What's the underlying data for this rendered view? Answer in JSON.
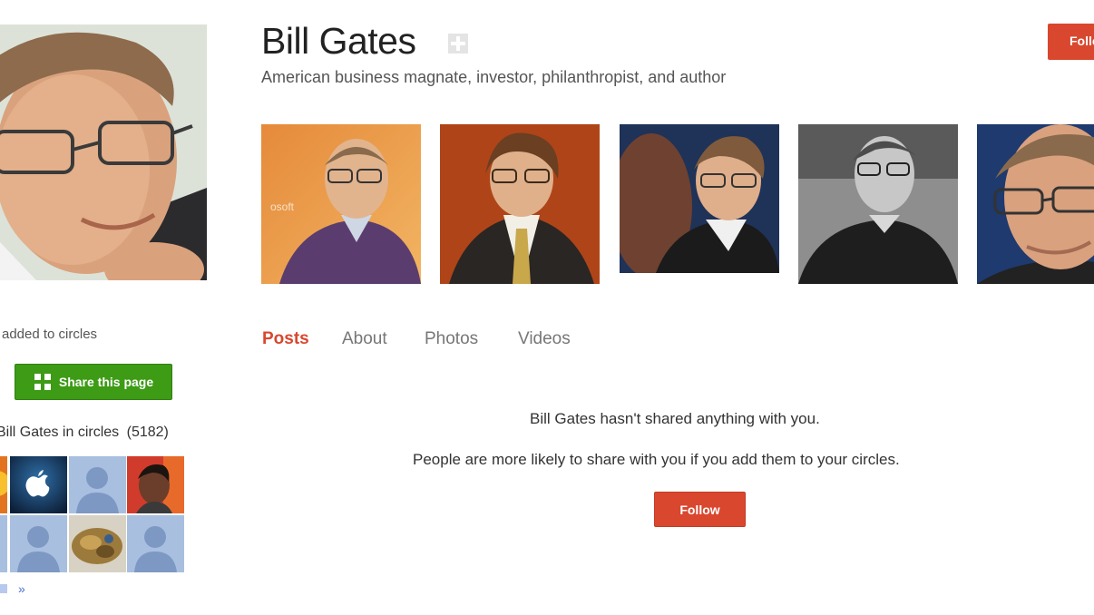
{
  "profile": {
    "name": "Bill Gates",
    "tagline": "American business magnate, investor, philanthropist, and author",
    "photo_icon": "profile-photo",
    "verify_icon": "google-plus-badge-icon"
  },
  "header": {
    "follow_label": "Follow"
  },
  "sidebar": {
    "added_text": "added to circles",
    "share_label": "Share this page",
    "circles_title": "Bill Gates in circles",
    "circles_count": "5182",
    "more_link": "»"
  },
  "tabs": [
    {
      "label": "Posts",
      "active": true
    },
    {
      "label": "About",
      "active": false
    },
    {
      "label": "Photos",
      "active": false
    },
    {
      "label": "Videos",
      "active": false
    }
  ],
  "empty_state": {
    "line1": "Bill Gates hasn't shared anything with you.",
    "line2": "People are more likely to share with you if you add them to your circles.",
    "follow_label": "Follow"
  },
  "colors": {
    "accent_red": "#d9472f",
    "share_green": "#3d9b16",
    "link_blue": "#4a6fd0"
  }
}
